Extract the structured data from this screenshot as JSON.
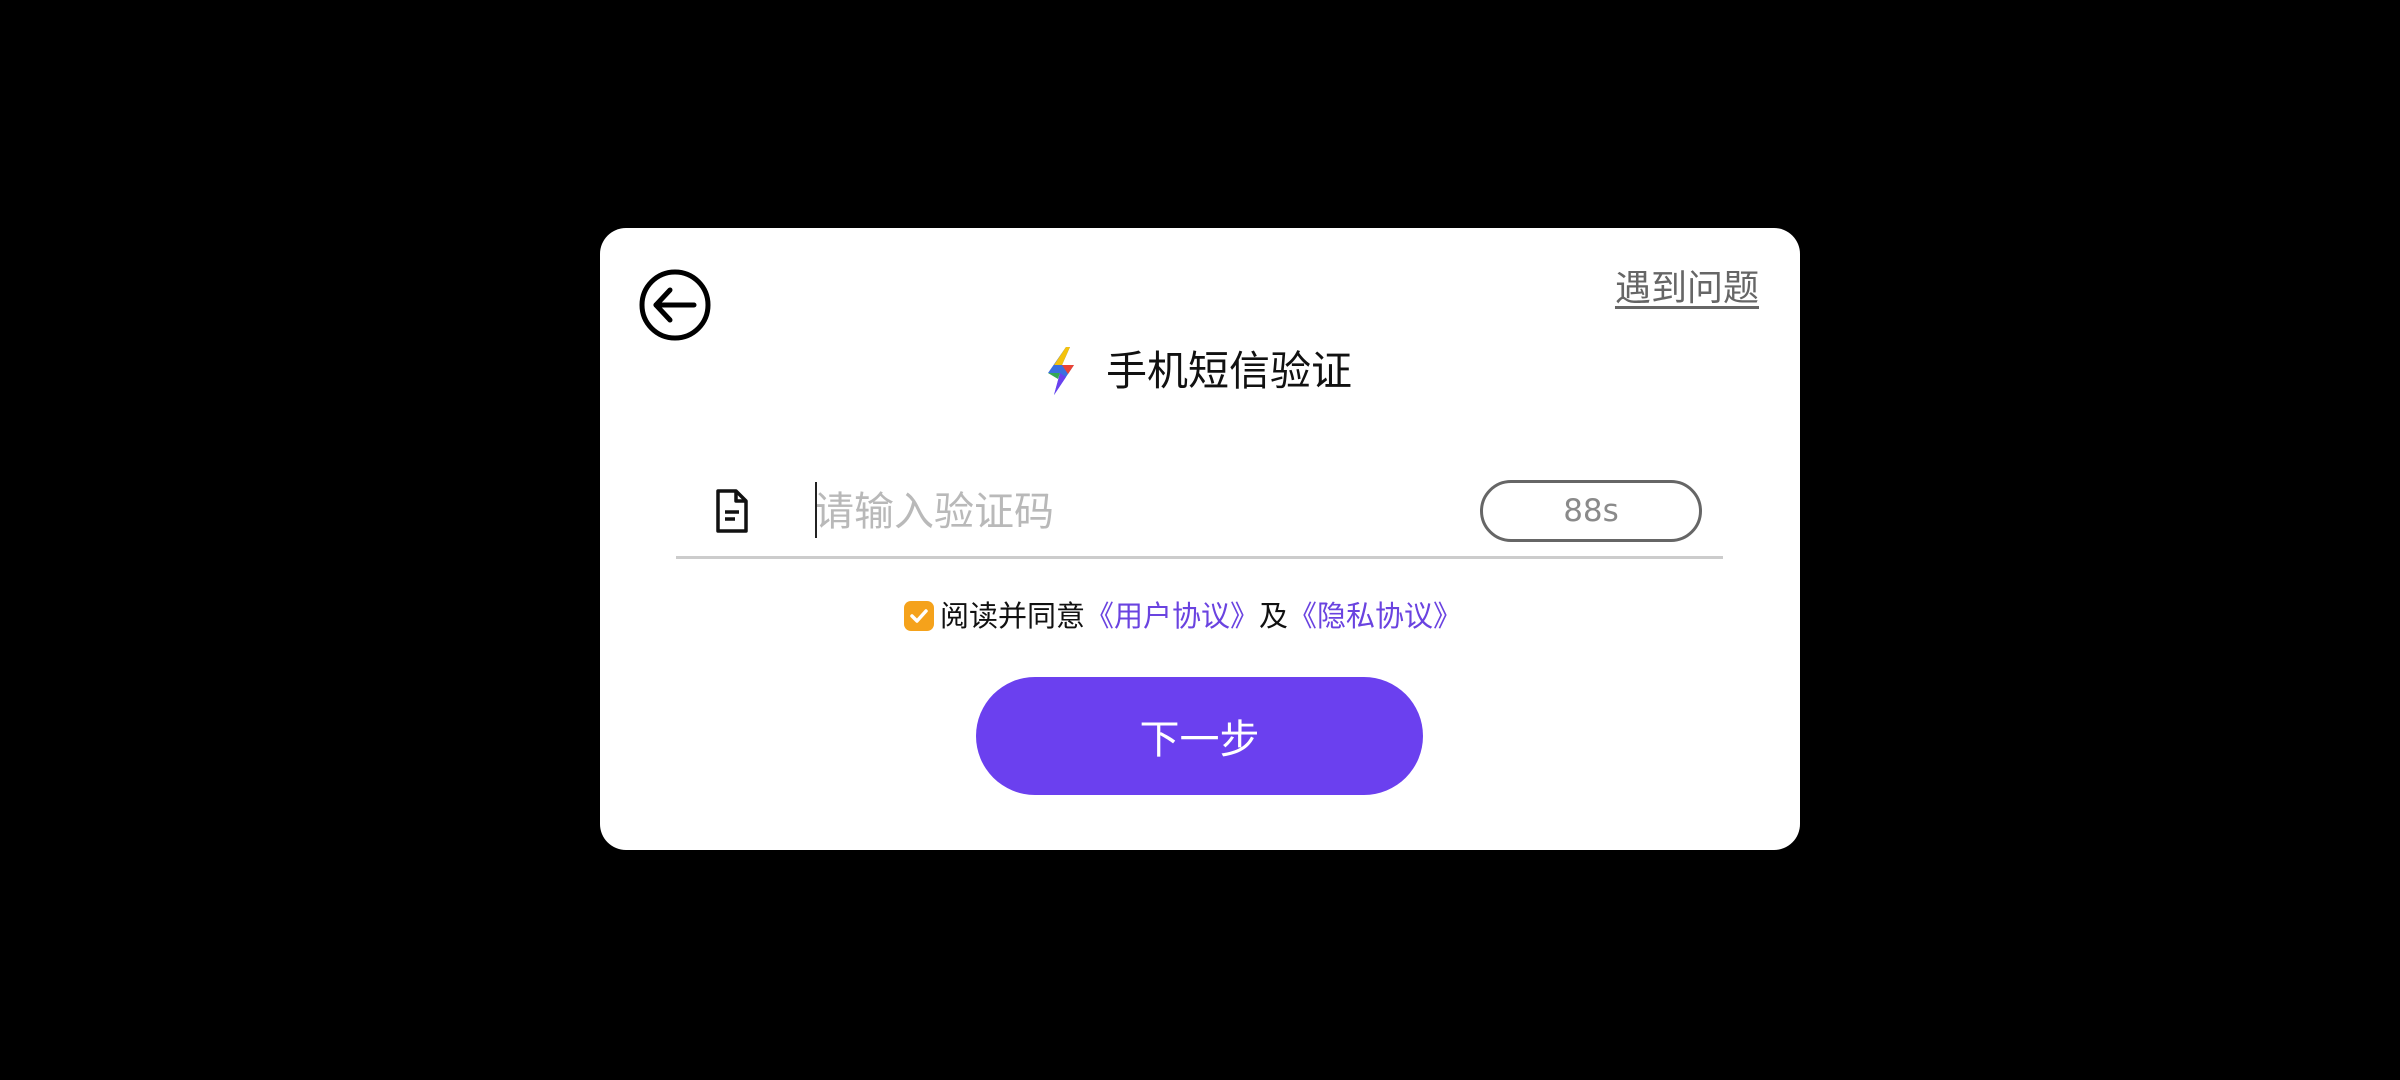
{
  "dialog": {
    "help_link": "遇到问题",
    "title": "手机短信验证",
    "code_input": {
      "placeholder": "请输入验证码",
      "value": ""
    },
    "countdown": "88s",
    "agreement": {
      "checked": true,
      "prefix": "阅读并同意",
      "user_agreement": "《用户协议》",
      "conjunction": "及",
      "privacy_policy": "《隐私协议》"
    },
    "next_button": "下一步"
  },
  "colors": {
    "background": "#000000",
    "dialog": "#ffffff",
    "accent": "#6b40ef",
    "link": "#6a43e0",
    "checkbox": "#f5a21b"
  },
  "icons": [
    "back-arrow-icon",
    "lightning-bolt-icon",
    "document-icon",
    "checkmark-icon"
  ]
}
